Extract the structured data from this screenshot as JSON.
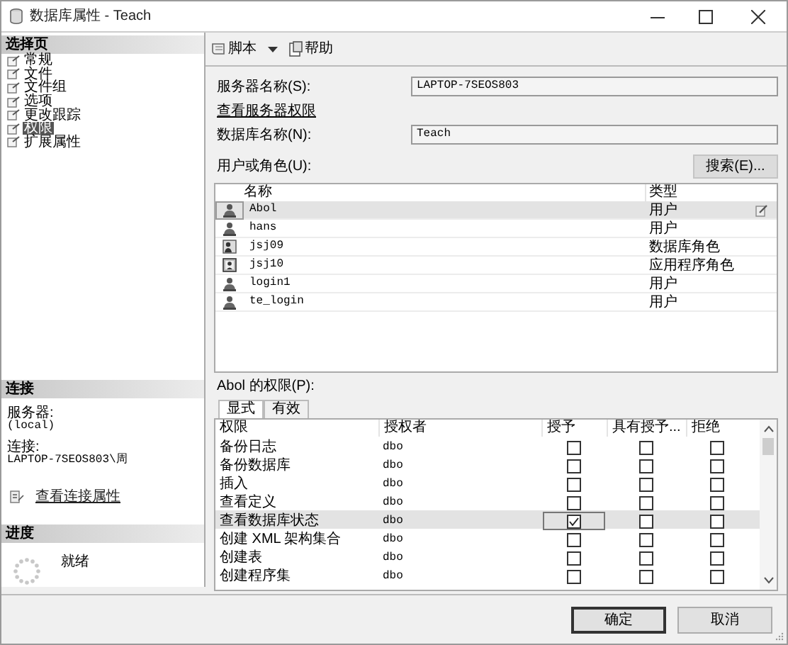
{
  "window": {
    "title": "数据库属性 - Teach"
  },
  "sidebar": {
    "header": "选择页",
    "items": [
      {
        "label": "常规",
        "selected": false
      },
      {
        "label": "文件",
        "selected": false
      },
      {
        "label": "文件组",
        "selected": false
      },
      {
        "label": "选项",
        "selected": false
      },
      {
        "label": "更改跟踪",
        "selected": false
      },
      {
        "label": "权限",
        "selected": true
      },
      {
        "label": "扩展属性",
        "selected": false
      }
    ]
  },
  "connection": {
    "header": "连接",
    "server_label": "服务器:",
    "server": "(local)",
    "connection_label": "连接:",
    "connection": "LAPTOP-7SEOS803\\周",
    "link": "查看连接属性"
  },
  "progress": {
    "header": "进度",
    "status": "就绪"
  },
  "toolbar": [
    {
      "label": "脚本",
      "kind": "dropdown"
    },
    {
      "label": "帮助",
      "kind": "help"
    }
  ],
  "form": {
    "server_name_label": "服务器名称(S):",
    "server_name": "LAPTOP-7SEOS803",
    "server_perms_link": "查看服务器权限",
    "db_name_label": "数据库名称(N):",
    "db_name": "Teach",
    "users_label": "用户或角色(U):",
    "search_button": "搜索(E)..."
  },
  "users": {
    "columns": [
      "名称",
      "类型"
    ],
    "rows": [
      {
        "name": "Abol",
        "type": "用户",
        "kind": "user",
        "selected": true
      },
      {
        "name": "hans",
        "type": "用户",
        "kind": "user",
        "selected": false
      },
      {
        "name": "jsj09",
        "type": "数据库角色",
        "kind": "db_role",
        "selected": false
      },
      {
        "name": "jsj10",
        "type": "应用程序角色",
        "kind": "app_role",
        "selected": false
      },
      {
        "name": "login1",
        "type": "用户",
        "kind": "user",
        "selected": false
      },
      {
        "name": "te_login",
        "type": "用户",
        "kind": "user",
        "selected": false
      }
    ]
  },
  "permissions": {
    "label": "Abol 的权限(P):",
    "tabs": [
      {
        "label": "显式",
        "selected": true
      },
      {
        "label": "有效",
        "selected": false
      }
    ],
    "columns": [
      "权限",
      "授权者",
      "授予",
      "具有授予...",
      "拒绝"
    ],
    "rows": [
      {
        "permission": "备份日志",
        "grantor": "dbo",
        "grant": false,
        "with_grant": false,
        "deny": false,
        "selected": false
      },
      {
        "permission": "备份数据库",
        "grantor": "dbo",
        "grant": false,
        "with_grant": false,
        "deny": false,
        "selected": false
      },
      {
        "permission": "插入",
        "grantor": "dbo",
        "grant": false,
        "with_grant": false,
        "deny": false,
        "selected": false
      },
      {
        "permission": "查看定义",
        "grantor": "dbo",
        "grant": false,
        "with_grant": false,
        "deny": false,
        "selected": false
      },
      {
        "permission": "查看数据库状态",
        "grantor": "dbo",
        "grant": true,
        "with_grant": false,
        "deny": false,
        "selected": true
      },
      {
        "permission": "创建 XML 架构集合",
        "grantor": "dbo",
        "grant": false,
        "with_grant": false,
        "deny": false,
        "selected": false
      },
      {
        "permission": "创建表",
        "grantor": "dbo",
        "grant": false,
        "with_grant": false,
        "deny": false,
        "selected": false
      },
      {
        "permission": "创建程序集",
        "grantor": "dbo",
        "grant": false,
        "with_grant": false,
        "deny": false,
        "selected": false
      }
    ]
  },
  "buttons": [
    {
      "label": "确定",
      "default": true
    },
    {
      "label": "取消",
      "default": false
    }
  ]
}
